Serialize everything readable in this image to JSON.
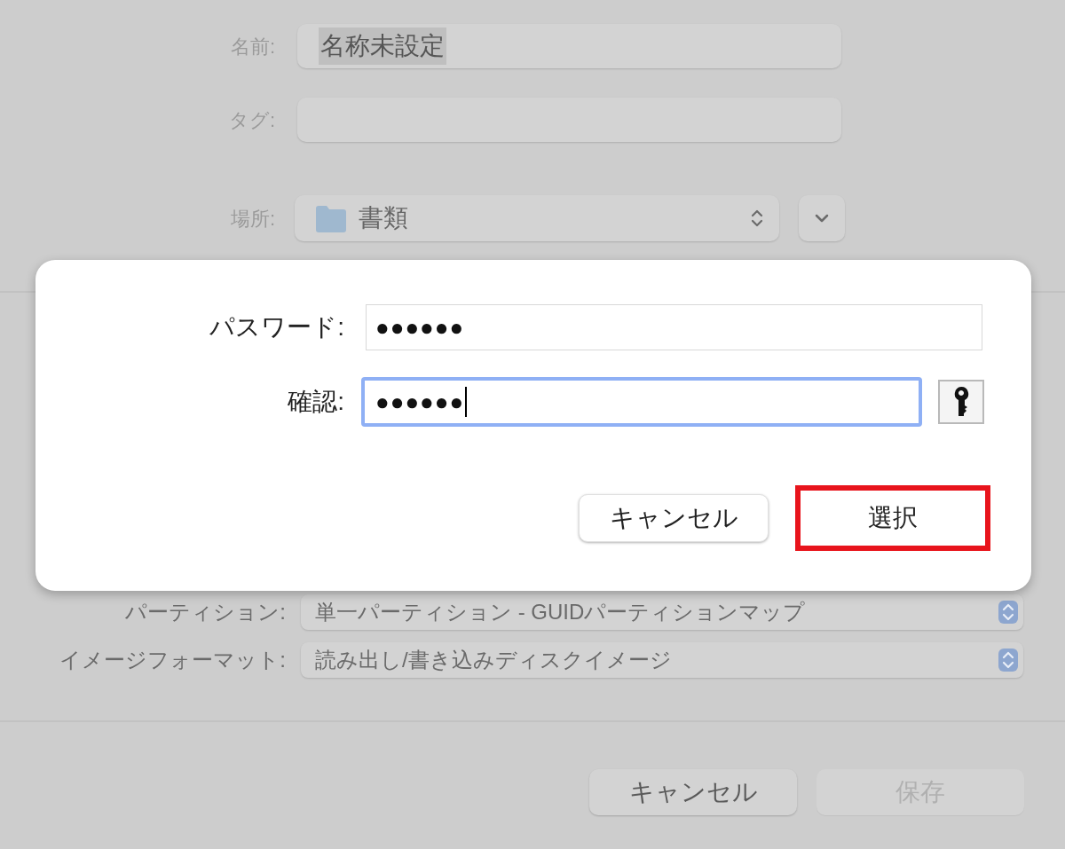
{
  "save_dialog": {
    "fields": [
      {
        "label": "名前:",
        "value": "名称未設定"
      },
      {
        "label": "タグ:"
      }
    ],
    "location": {
      "label": "場所:",
      "value": "書類"
    },
    "options": [
      {
        "label": "パーティション:",
        "value": "単一パーティション - GUIDパーティションマップ"
      },
      {
        "label": "イメージフォーマット:",
        "value": "読み出し/書き込みディスクイメージ"
      }
    ],
    "buttons": [
      {
        "label": "キャンセル",
        "disabled": false
      },
      {
        "label": "保存",
        "disabled": true
      }
    ]
  },
  "password_sheet": {
    "fields": [
      {
        "label": "パスワード:",
        "value": "●●●●●●",
        "focused": false
      },
      {
        "label": "確認:",
        "value": "●●●●●●",
        "focused": true
      }
    ],
    "buttons": [
      {
        "label": "キャンセル",
        "highlighted": false
      },
      {
        "label": "選択",
        "highlighted": true
      }
    ]
  }
}
